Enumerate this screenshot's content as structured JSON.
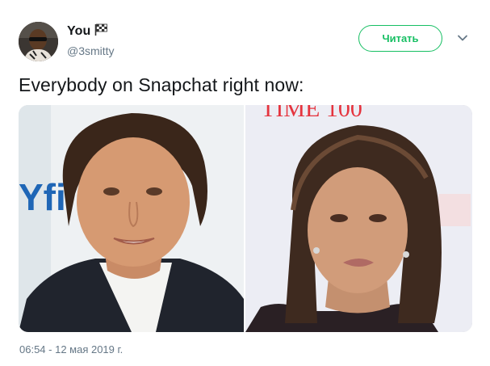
{
  "author": {
    "display_name": "You",
    "handle": "@3smitty",
    "avatar_icon": "profile-photo",
    "flag_icon": "checkered-flag-icon"
  },
  "follow_button": {
    "label": "Читать",
    "color": "#17bf63"
  },
  "menu_icon": "chevron-down-icon",
  "tweet": {
    "text": "Everybody on Snapchat right now:",
    "photos": [
      {
        "description_icon": "photo-before"
      },
      {
        "description_icon": "photo-after"
      }
    ],
    "timestamp": "06:54 - 12 мая 2019 г."
  },
  "photo_overlay_text": {
    "left_logo_fragment": "Yfi",
    "right_magazine_title": "TIME 100"
  },
  "colors": {
    "text_primary": "#14171a",
    "text_secondary": "#657786"
  }
}
